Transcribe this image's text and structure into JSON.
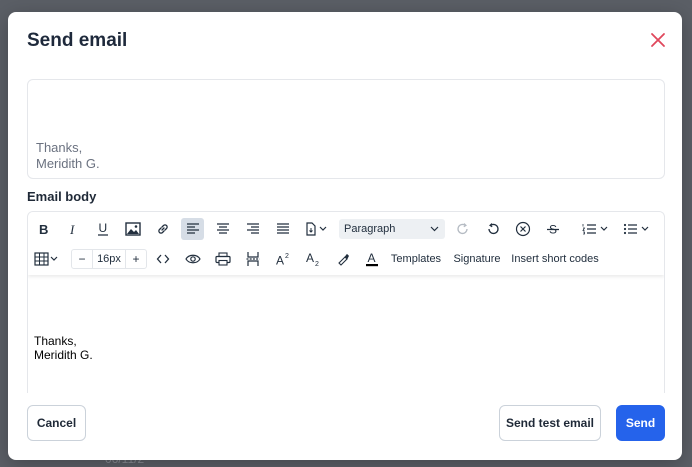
{
  "modal": {
    "title": "Send email"
  },
  "preview": {
    "text": "Thanks,\nMeridith G."
  },
  "email_body": {
    "label": "Email body",
    "content": "Thanks,\nMeridith G."
  },
  "toolbar": {
    "paragraph_value": "Paragraph",
    "font_size": "16px",
    "decrease": "−",
    "increase": "+",
    "templates": "Templates",
    "signature": "Signature",
    "insert_short_codes": "Insert short codes"
  },
  "footer": {
    "cancel": "Cancel",
    "send_test": "Send test email",
    "send": "Send"
  },
  "background": {
    "date_hint": "06/11/2"
  },
  "colors": {
    "primary": "#2563eb",
    "close": "#e0475b",
    "active_tool": "#d6dde6"
  }
}
